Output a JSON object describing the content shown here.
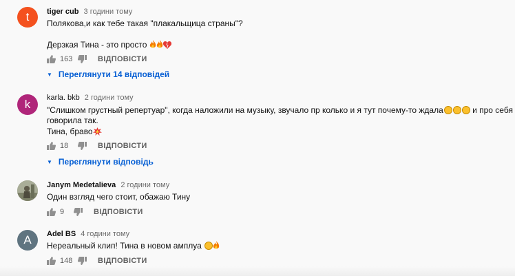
{
  "comments": [
    {
      "author": "tiger cub",
      "time": "3 години тому",
      "avatar_letter": "t",
      "avatar_color": "#f4511e",
      "lines": [
        "Полякова,и как тебе такая \"плакальщица страны\"?",
        "",
        "Дерзкая Тина - это просто"
      ],
      "likes": "163",
      "reply_label": "ВІДПОВІСТИ",
      "replies_label": "Переглянути 14 відповідей"
    },
    {
      "author": "karla. bkb",
      "time": "2 години тому",
      "avatar_letter": "k",
      "avatar_color": "#b0267a",
      "lines": [
        "\"Слишком грустный репертуар\", когда наложили на музыку, звучало пр колько и я тут почему-то ждала",
        "говорила так.",
        "Тина, браво"
      ],
      "line1_tail": "и про себя",
      "likes": "18",
      "reply_label": "ВІДПОВІСТИ",
      "replies_label": "Переглянути відповідь"
    },
    {
      "author": "Janym Medetalieva",
      "time": "2 години тому",
      "lines": [
        "Один взгляд чего стоит, обажаю Тину"
      ],
      "likes": "9",
      "reply_label": "ВІДПОВІСТИ"
    },
    {
      "author": "Adel BS",
      "time": "4 години тому",
      "avatar_letter": "A",
      "avatar_color": "#5f7480",
      "lines": [
        "Нереальный клип! Тина в новом амплуа"
      ],
      "likes": "148",
      "reply_label": "ВІДПОВІСТИ"
    }
  ]
}
